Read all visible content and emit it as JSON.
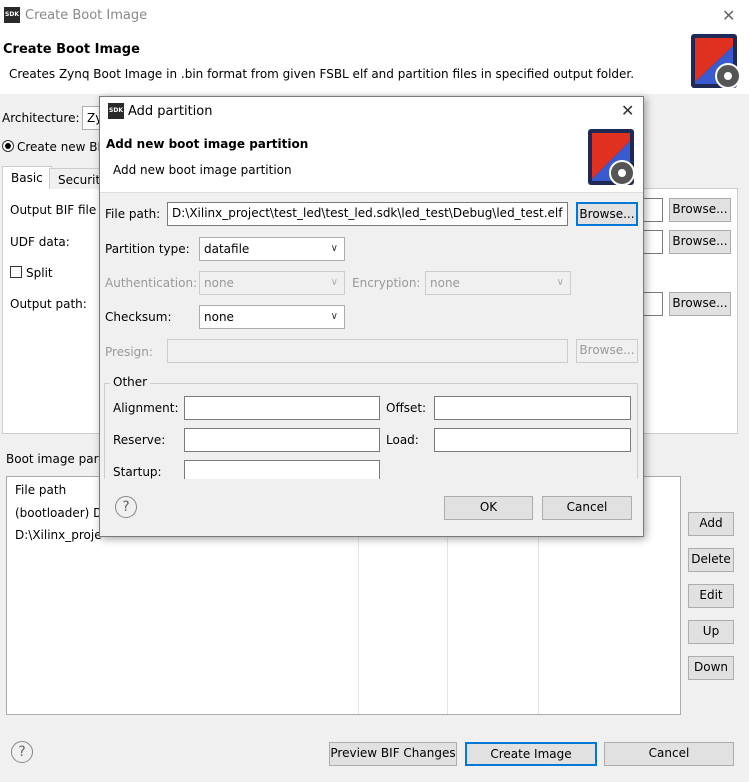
{
  "window": {
    "title": "Create Boot Image",
    "close_label": "✕"
  },
  "header": {
    "title": "Create Boot Image",
    "description": "Creates Zynq Boot Image in .bin format from given FSBL elf and partition files in specified output folder."
  },
  "main": {
    "architecture_label": "Architecture:",
    "architecture_value": "Zy",
    "create_new_bif_label": "Create new BI",
    "tabs": [
      "Basic",
      "Security"
    ],
    "output_bif_label": "Output BIF file",
    "udf_label": "UDF data:",
    "split_label": "Split",
    "output_path_label": "Output path:",
    "browse_label": "Browse...",
    "boot_partitions_label": "Boot image par",
    "table": {
      "header": "File path",
      "rows": [
        "(bootloader) D",
        "D:\\Xilinx_proje"
      ]
    },
    "side_buttons": [
      "Add",
      "Delete",
      "Edit",
      "Up",
      "Down"
    ]
  },
  "footer": {
    "preview_label": "Preview BIF Changes",
    "create_label": "Create Image",
    "cancel_label": "Cancel"
  },
  "dialog": {
    "title": "Add partition",
    "close_label": "✕",
    "heading": "Add new boot image partition",
    "subheading": "Add new boot image partition",
    "file_path_label": "File path:",
    "file_path_value": "D:\\Xilinx_project\\test_led\\test_led.sdk\\led_test\\Debug\\led_test.elf",
    "browse_label": "Browse...",
    "partition_type_label": "Partition type:",
    "partition_type_value": "datafile",
    "authentication_label": "Authentication:",
    "authentication_value": "none",
    "encryption_label": "Encryption:",
    "encryption_value": "none",
    "checksum_label": "Checksum:",
    "checksum_value": "none",
    "presign_label": "Presign:",
    "other_label": "Other",
    "alignment_label": "Alignment:",
    "offset_label": "Offset:",
    "reserve_label": "Reserve:",
    "load_label": "Load:",
    "startup_label": "Startup:",
    "ok_label": "OK",
    "cancel_label": "Cancel"
  },
  "icons": {
    "help": "?",
    "sdk": "SDK",
    "chevron": "∨"
  }
}
